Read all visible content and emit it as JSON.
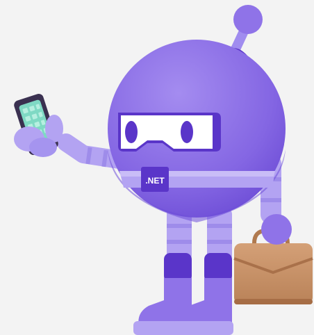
{
  "illustration": {
    "badge_text": ".NET"
  },
  "colors": {
    "background": "#f3f3f3",
    "body_purple": "#8f73e8",
    "body_shadow": "#6e4fd8",
    "dark_purple": "#5a35c9",
    "limb_lilac": "#b3a3f2",
    "visor_white": "#ffffff",
    "phone_screen": "#7fd9c4",
    "briefcase_tan": "#c99366"
  },
  "icons": {
    "phone": "smartphone-icon",
    "briefcase": "briefcase-icon",
    "badge": "dotnet-badge-icon"
  }
}
